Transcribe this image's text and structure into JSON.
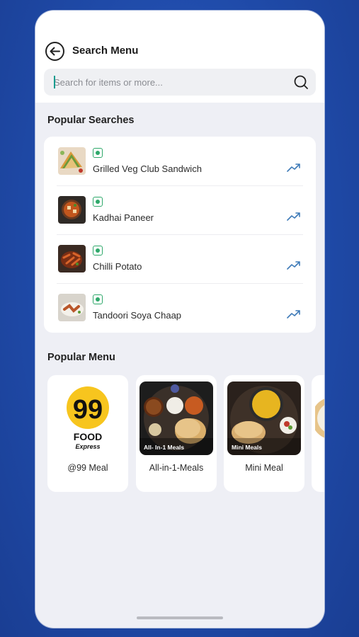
{
  "header": {
    "title": "Search Menu",
    "search_placeholder": "Search for items or more..."
  },
  "popular_searches": {
    "title": "Popular Searches",
    "items": [
      {
        "label": "Grilled Veg Club Sandwich"
      },
      {
        "label": "Kadhai Paneer"
      },
      {
        "label": "Chilli Potato"
      },
      {
        "label": "Tandoori Soya Chaap"
      }
    ]
  },
  "popular_menu": {
    "title": "Popular Menu",
    "items": [
      {
        "label": "@99 Meal",
        "logo_number": "99",
        "logo_word": "FOOD",
        "logo_sub": "Express"
      },
      {
        "label": "All-in-1-Meals",
        "overlay": "All- In-1 Meals"
      },
      {
        "label": "Mini Meal",
        "overlay": "Mini Meals"
      }
    ]
  },
  "colors": {
    "veg_green": "#2ea86a",
    "trend_blue": "#3f7bb8",
    "background_blue": "#1f4aa8",
    "logo_yellow": "#f7c51e"
  }
}
